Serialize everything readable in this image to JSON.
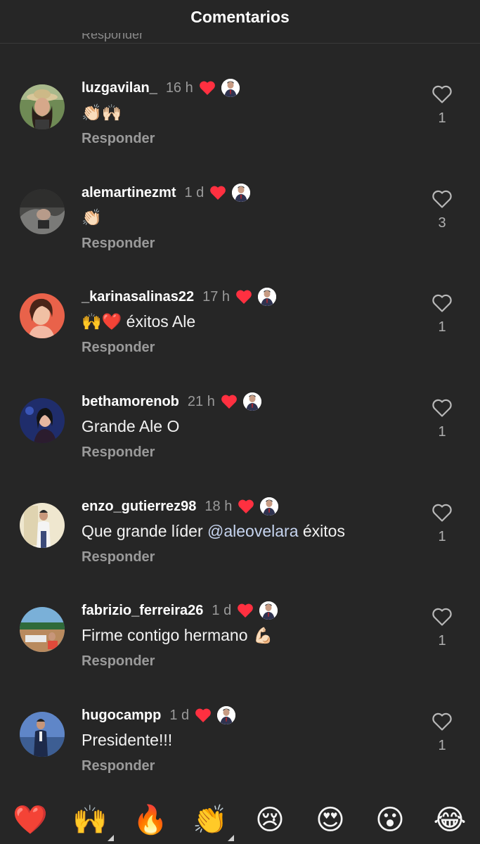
{
  "header": {
    "title": "Comentarios",
    "peek_text": "Responder"
  },
  "icons": {
    "liked_by_author": "red-heart-icon",
    "author_badge": "author-avatar-icon",
    "like": "heart-outline-icon"
  },
  "colors": {
    "background": "#262626",
    "heart": "#ff3040",
    "mention": "#c6d4ef",
    "muted": "#9a9a9a"
  },
  "comments": [
    {
      "username": "luzgavilan_",
      "time": "16 h",
      "text": "👏🏻🙌🏻",
      "reply": "Responder",
      "likes": "1"
    },
    {
      "username": "alemartinezmt",
      "time": "1 d",
      "text": "👏🏻",
      "reply": "Responder",
      "likes": "3"
    },
    {
      "username": "_karinasalinas22",
      "time": "17 h",
      "text": "🙌❤️ éxitos Ale",
      "reply": "Responder",
      "likes": "1"
    },
    {
      "username": "bethamorenob",
      "time": "21 h",
      "text": "Grande Ale O",
      "reply": "Responder",
      "likes": "1"
    },
    {
      "username": "enzo_gutierrez98",
      "time": "18 h",
      "text_before": "Que grande líder ",
      "mention": "@aleovelara",
      "text_after": " éxitos",
      "reply": "Responder",
      "likes": "1"
    },
    {
      "username": "fabrizio_ferreira26",
      "time": "1 d",
      "text": "Firme contigo hermano",
      "text_emoji": "💪🏻",
      "reply": "Responder",
      "likes": "1"
    },
    {
      "username": "hugocampp",
      "time": "1 d",
      "text": "Presidente!!!",
      "reply": "Responder",
      "likes": "1"
    }
  ],
  "reactions": [
    "❤️",
    "🙌",
    "🔥",
    "👏",
    "😢",
    "😍",
    "😮",
    "😂"
  ]
}
